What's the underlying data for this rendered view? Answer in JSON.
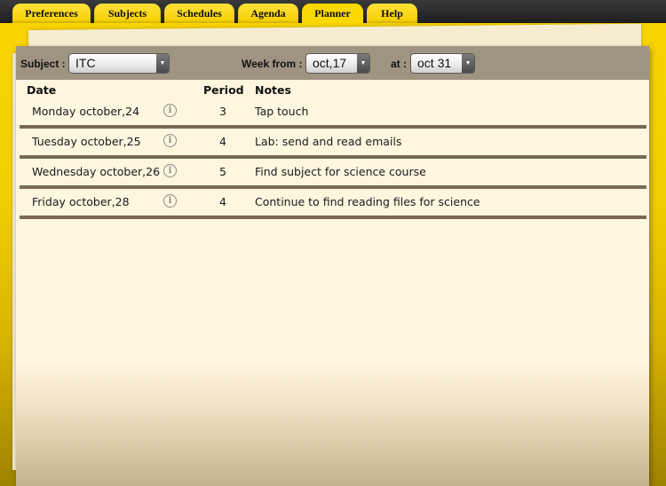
{
  "tabs": [
    {
      "label": "Preferences",
      "active": false
    },
    {
      "label": "Subjects",
      "active": false
    },
    {
      "label": "Schedules",
      "active": false
    },
    {
      "label": "Agenda",
      "active": false
    },
    {
      "label": "Planner",
      "active": true
    },
    {
      "label": "Help",
      "active": false
    }
  ],
  "toolbar": {
    "subject_label": "Subject :",
    "subject_value": "ITC",
    "week_from_label": "Week from :",
    "week_from_value": "oct,17",
    "at_label": "at :",
    "at_value": "oct 31"
  },
  "table": {
    "columns": {
      "date": "Date",
      "period": "Period",
      "notes": "Notes"
    },
    "rows": [
      {
        "date": "Monday october,24",
        "period": "3",
        "notes": "Tap touch"
      },
      {
        "date": "Tuesday october,25",
        "period": "4",
        "notes": "Lab: send and read emails"
      },
      {
        "date": "Wednesday october,26",
        "period": "5",
        "notes": "Find subject for science course"
      },
      {
        "date": "Friday october,28",
        "period": "4",
        "notes": "Continue to find reading files for science"
      }
    ]
  },
  "icons": {
    "info": "ⓘ",
    "dropdown": "▼"
  }
}
